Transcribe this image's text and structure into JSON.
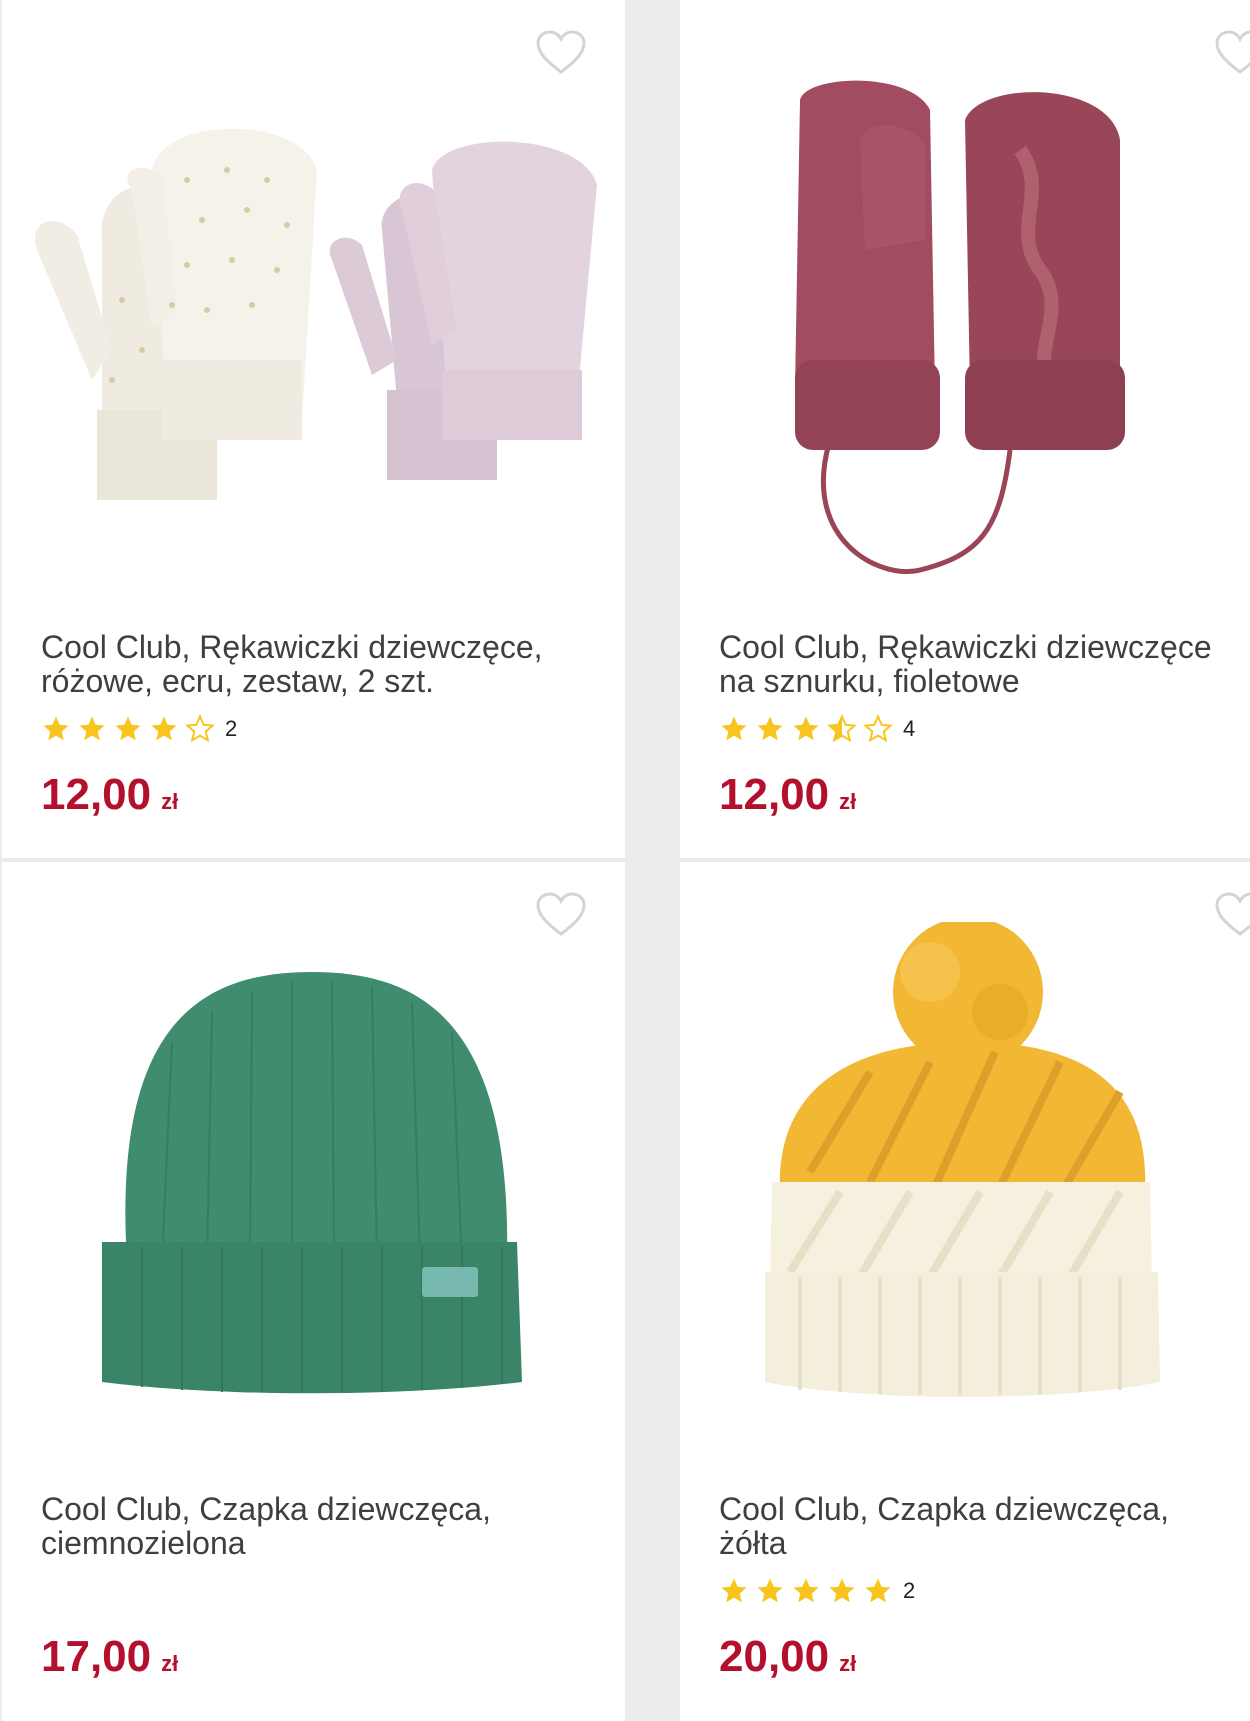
{
  "products": [
    {
      "title_line1": "Cool Club, Rękawiczki dziewczęce,",
      "title_line2": "różowe, ecru, zestaw, 2 szt.",
      "rating": 4,
      "rating_count": "2",
      "price": "12,00",
      "currency": "zł",
      "image_icon": "mittens-set-icon",
      "colors": {
        "primary": "#f3efe6",
        "secondary": "#dcc9d8"
      }
    },
    {
      "title_line1": "Cool Club, Rękawiczki dziewczęce",
      "title_line2": "na sznurku, fioletowe",
      "rating": 3.5,
      "rating_count": "4",
      "price": "12,00",
      "currency": "zł",
      "image_icon": "mittens-on-string-icon",
      "colors": {
        "primary": "#9c4a5f"
      }
    },
    {
      "title_line1": "Cool Club, Czapka dziewczęca,",
      "title_line2": "ciemnozielona",
      "rating": 0,
      "rating_count": "",
      "price": "17,00",
      "currency": "zł",
      "image_icon": "beanie-hat-icon",
      "colors": {
        "primary": "#3e8a6c",
        "label": "#77b8ae"
      }
    },
    {
      "title_line1": "Cool Club, Czapka dziewczęca,",
      "title_line2": "żółta",
      "rating": 5,
      "rating_count": "2",
      "price": "20,00",
      "currency": "zł",
      "image_icon": "pompom-hat-icon",
      "colors": {
        "primary": "#f0b533",
        "secondary": "#f5f0df"
      }
    }
  ],
  "theme": {
    "price_color": "#b3102e",
    "star_color": "#f7c51d",
    "title_color": "#3f3f3f"
  }
}
